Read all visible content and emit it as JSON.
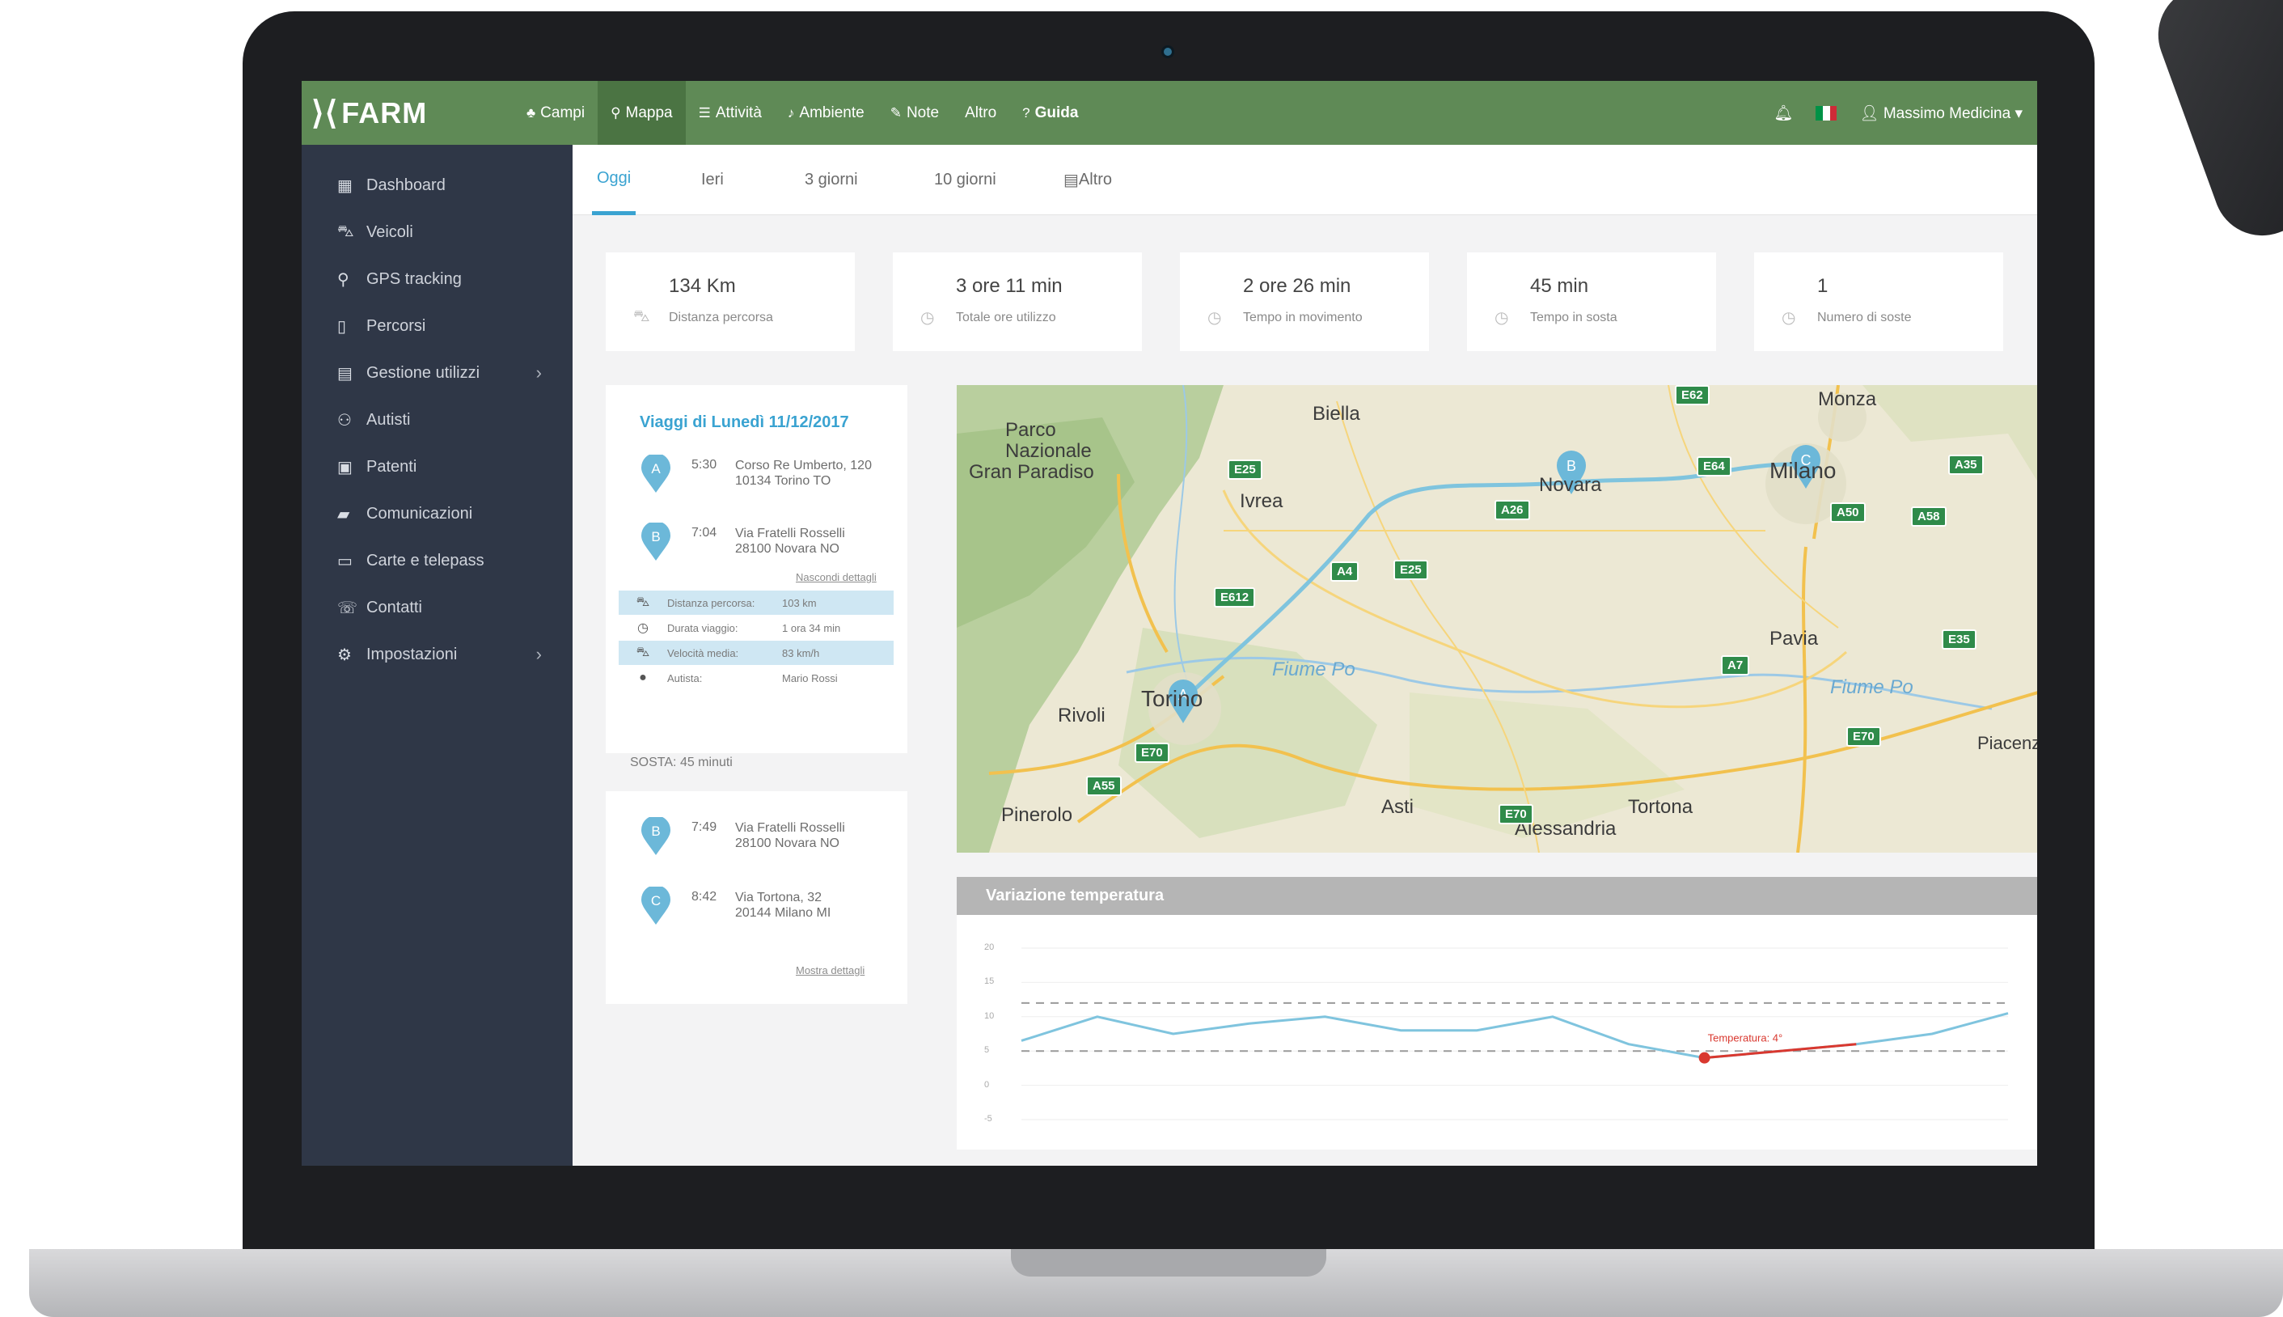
{
  "app": {
    "logo": "FARM"
  },
  "topnav": {
    "items": [
      {
        "icon": "tree-icon",
        "label": "Campi"
      },
      {
        "icon": "map-pin-icon",
        "label": "Mappa"
      },
      {
        "icon": "list-icon",
        "label": "Attività"
      },
      {
        "icon": "bell-icon",
        "label": "Ambiente"
      },
      {
        "icon": "edit-icon",
        "label": "Note"
      },
      {
        "icon": "",
        "label": "Altro"
      },
      {
        "icon": "help-icon",
        "label": "Guida"
      }
    ],
    "active_index": 1,
    "user": "Massimo Medicina"
  },
  "sidebar": {
    "items": [
      {
        "icon": "dashboard-icon",
        "label": "Dashboard"
      },
      {
        "icon": "car-icon",
        "label": "Veicoli"
      },
      {
        "icon": "map-pin-icon",
        "label": "GPS tracking"
      },
      {
        "icon": "map-icon",
        "label": "Percorsi"
      },
      {
        "icon": "calendar-icon",
        "label": "Gestione utilizzi",
        "chevron": "›"
      },
      {
        "icon": "users-icon",
        "label": "Autisti"
      },
      {
        "icon": "id-card-icon",
        "label": "Patenti"
      },
      {
        "icon": "chat-icon",
        "label": "Comunicazioni"
      },
      {
        "icon": "credit-card-icon",
        "label": "Carte e telepass"
      },
      {
        "icon": "phone-icon",
        "label": "Contatti"
      },
      {
        "icon": "gear-icon",
        "label": "Impostazioni",
        "chevron": "›"
      }
    ]
  },
  "tabs": {
    "items": [
      "Oggi",
      "Ieri",
      "3 giorni",
      "10 giorni",
      "Altro"
    ],
    "active_index": 0
  },
  "stats": [
    {
      "value": "134 Km",
      "label": "Distanza percorsa",
      "icon": "car-icon"
    },
    {
      "value": "3 ore 11 min",
      "label": "Totale ore utilizzo",
      "icon": "clock-icon"
    },
    {
      "value": "2 ore 26 min",
      "label": "Tempo in movimento",
      "icon": "clock-icon"
    },
    {
      "value": "45 min",
      "label": "Tempo in sosta",
      "icon": "clock-icon"
    },
    {
      "value": "1",
      "label": "Numero di soste",
      "icon": "clock-icon"
    }
  ],
  "trips": {
    "title": "Viaggi di Lunedì 11/12/2017",
    "first": [
      {
        "marker": "A",
        "time": "5:30",
        "addr1": "Corso Re Umberto, 120",
        "addr2": "10134 Torino TO"
      },
      {
        "marker": "B",
        "time": "7:04",
        "addr1": "Via Fratelli Rosselli",
        "addr2": "28100 Novara NO"
      }
    ],
    "hide_details": "Nascondi dettagli",
    "details": [
      {
        "icon": "car-icon",
        "label": "Distanza percorsa:",
        "value": "103 km"
      },
      {
        "icon": "clock-icon",
        "label": "Durata viaggio:",
        "value": "1 ora 34 min"
      },
      {
        "icon": "car-icon",
        "label": "Velocità media:",
        "value": "83 km/h"
      },
      {
        "icon": "user-icon",
        "label": "Autista:",
        "value": "Mario Rossi"
      }
    ],
    "sosta": "SOSTA: 45 minuti",
    "second": [
      {
        "marker": "B",
        "time": "7:49",
        "addr1": "Via Fratelli Rosselli",
        "addr2": "28100 Novara NO"
      },
      {
        "marker": "C",
        "time": "8:42",
        "addr1": "Via Tortona, 32",
        "addr2": "20144 Milano MI"
      }
    ],
    "show_details": "Mostra dettagli"
  },
  "map": {
    "labels": [
      {
        "text": "Biella"
      },
      {
        "text": "Parco"
      },
      {
        "text": "Nazionale"
      },
      {
        "text": "Gran Paradiso"
      },
      {
        "text": "Ivrea"
      },
      {
        "text": "Novara"
      },
      {
        "text": "Monza"
      },
      {
        "text": "Milano"
      },
      {
        "text": "Pavia"
      },
      {
        "text": "Fiume Po"
      },
      {
        "text": "Fiume Po"
      },
      {
        "text": "Torino"
      },
      {
        "text": "Rivoli"
      },
      {
        "text": "Pinerolo"
      },
      {
        "text": "Asti"
      },
      {
        "text": "Alessandria"
      },
      {
        "text": "Tortona"
      },
      {
        "text": "Piacenza"
      }
    ],
    "shields": [
      "E62",
      "E25",
      "A35",
      "E64",
      "A26",
      "A50",
      "A58",
      "A4",
      "E25",
      "E612",
      "E35",
      "A7",
      "E70",
      "E70",
      "E70",
      "A55"
    ],
    "markers": [
      "A",
      "B",
      "C"
    ]
  },
  "temperature": {
    "title": "Variazione temperatura",
    "yticks": [
      "20",
      "15",
      "10",
      "5",
      "0",
      "-5"
    ],
    "annotation": "Temperatura: 4°",
    "colors": {
      "line": "#7fc4de",
      "marker": "#d9382f",
      "threshold": "#9a9a9a"
    }
  },
  "chart_data": {
    "type": "line",
    "title": "Variazione temperatura",
    "ylim": [
      -5,
      20
    ],
    "yticks": [
      20,
      15,
      10,
      5,
      0,
      -5
    ],
    "thresholds": [
      12,
      5
    ],
    "series": [
      {
        "values": [
          6.5,
          10,
          7.5,
          9,
          10,
          8,
          8,
          10,
          6,
          4,
          5,
          6,
          7.5,
          10.5
        ]
      }
    ],
    "highlight": {
      "index": 9,
      "value": 4,
      "label": "Temperatura: 4°"
    }
  }
}
